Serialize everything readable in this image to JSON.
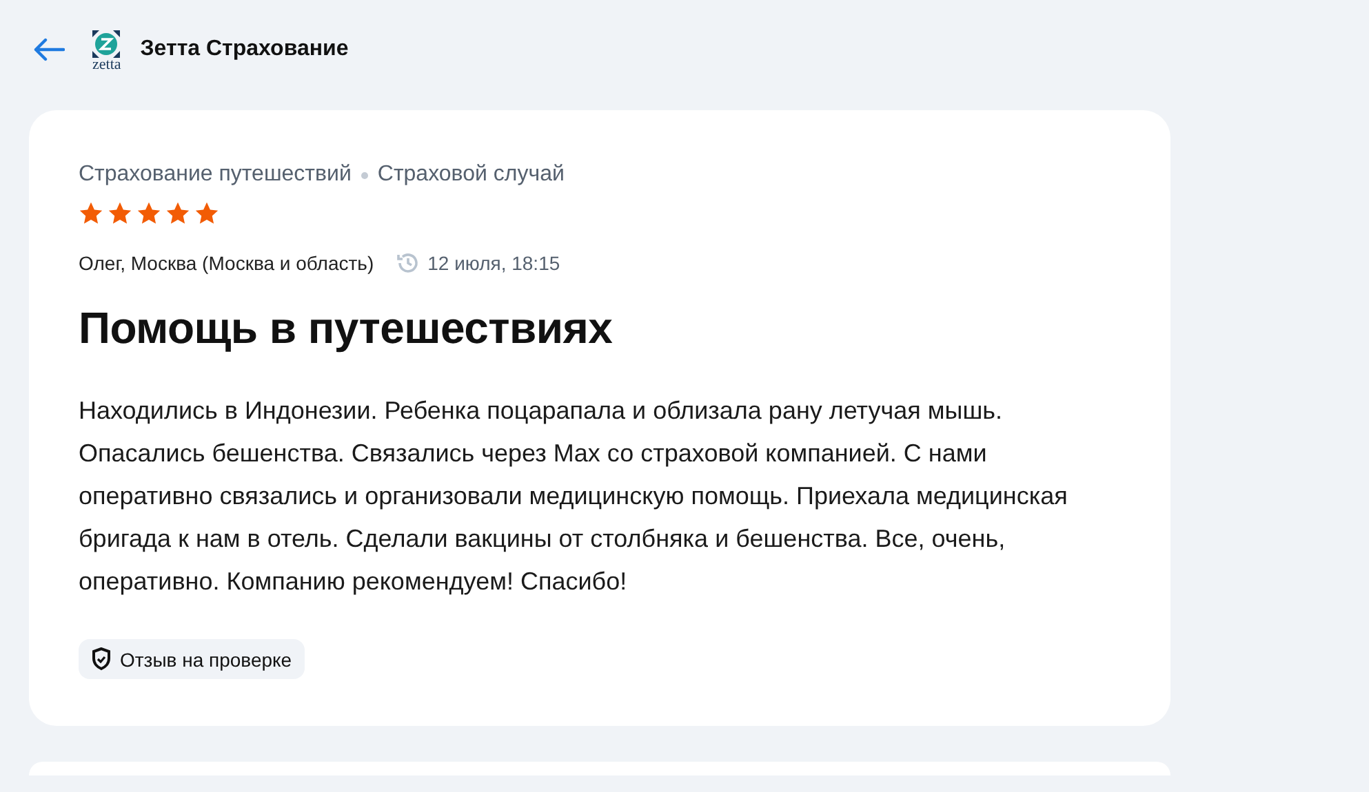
{
  "header": {
    "logo_text": "zetta",
    "company": "Зетта Страхование"
  },
  "review": {
    "category": "Страхование путешествий",
    "topic": "Страховой случай",
    "stars": 5,
    "author": "Олег, Москва (Москва и область)",
    "date": "12 июля, 18:15",
    "title": "Помощь в путешествиях",
    "text": "Находились в Индонезии. Ребенка поцарапала и облизала рану летучая мышь. Опасались бешенства. Связались через Max со страховой компанией. С нами оперативно связались и организовали медицинскую помощь. Приехала медицинская бригада к нам в отель. Сделали вакцины от столбняка и бешенства. Все, очень, оперативно. Компанию рекомендуем! Спасибо!",
    "status": "Отзыв на проверке"
  }
}
